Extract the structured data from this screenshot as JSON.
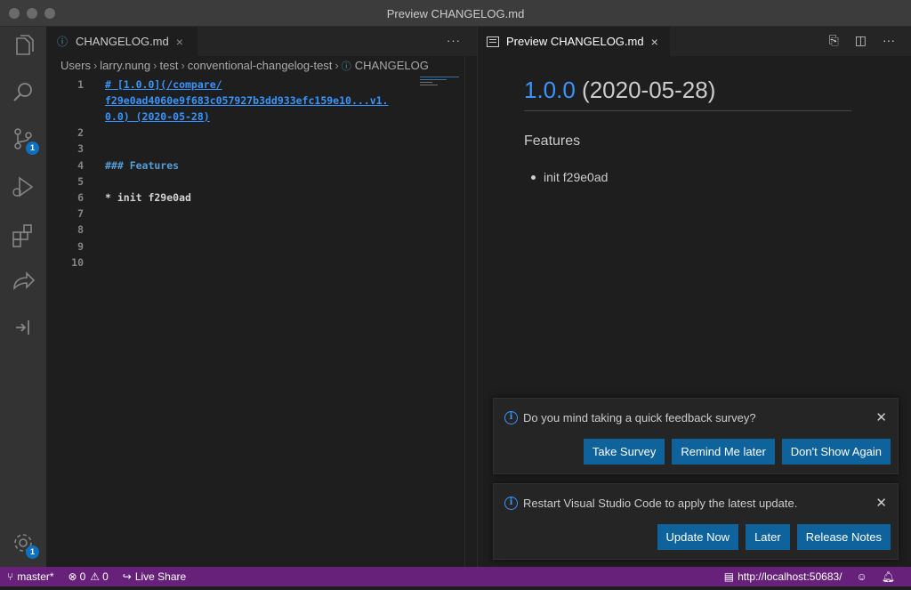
{
  "window": {
    "title": "Preview CHANGELOG.md"
  },
  "activity_bar": {
    "items": [
      {
        "name": "explorer-icon"
      },
      {
        "name": "search-icon"
      },
      {
        "name": "source-control-icon",
        "badge": "1"
      },
      {
        "name": "run-debug-icon"
      },
      {
        "name": "extensions-icon"
      },
      {
        "name": "live-share-icon"
      },
      {
        "name": "remote-explorer-icon"
      }
    ],
    "settings_badge": "1"
  },
  "editor": {
    "tab": {
      "label": "CHANGELOG.md",
      "close": "×"
    },
    "more": "···",
    "breadcrumb": [
      "Users",
      "larry.nung",
      "test",
      "conventional-changelog-test",
      "CHANGELOG"
    ],
    "lines": [
      {
        "n": "1",
        "text": "# [1.0.0](/compare/"
      },
      {
        "n": "",
        "text": "f29e0ad4060e9f683c057927b3dd933efc159e10...v1."
      },
      {
        "n": "",
        "text": "0.0) (2020-05-28)"
      },
      {
        "n": "2",
        "text": ""
      },
      {
        "n": "3",
        "text": ""
      },
      {
        "n": "4",
        "text": "### Features"
      },
      {
        "n": "5",
        "text": ""
      },
      {
        "n": "6",
        "text": "* init f29e0ad"
      },
      {
        "n": "7",
        "text": ""
      },
      {
        "n": "8",
        "text": ""
      },
      {
        "n": "9",
        "text": ""
      },
      {
        "n": "10",
        "text": ""
      }
    ]
  },
  "preview": {
    "tab": {
      "label": "Preview CHANGELOG.md",
      "close": "×"
    },
    "actions": [
      "open-source-icon",
      "split-editor-icon",
      "more-actions-icon"
    ],
    "h1_link": "1.0.0",
    "h1_date": " (2020-05-28)",
    "h3": "Features",
    "list": [
      "init f29e0ad"
    ]
  },
  "notifications": [
    {
      "message": "Do you mind taking a quick feedback survey?",
      "buttons": [
        "Take Survey",
        "Remind Me later",
        "Don't Show Again"
      ]
    },
    {
      "message": "Restart Visual Studio Code to apply the latest update.",
      "buttons": [
        "Update Now",
        "Later",
        "Release Notes"
      ]
    }
  ],
  "statusbar": {
    "branch": "master*",
    "errors": "0",
    "warnings": "0",
    "live_share": "Live Share",
    "url": "http://localhost:50683/",
    "color": "#68217a"
  }
}
